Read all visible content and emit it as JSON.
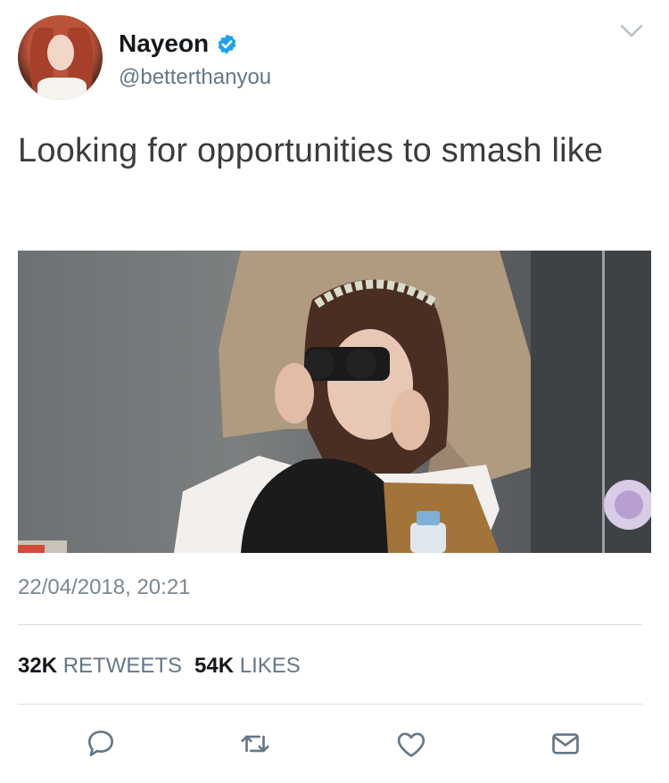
{
  "author": {
    "name": "Nayeon",
    "handle": "@betterthanyou",
    "verified": true
  },
  "tweet": {
    "text": "Looking for opportunities to smash like",
    "timestamp": "22/04/2018, 20:21"
  },
  "stats": {
    "retweets_count": "32K",
    "retweets_label": "RETWEETS",
    "likes_count": "54K",
    "likes_label": "LIKES"
  },
  "colors": {
    "verified_blue": "#1da1f2",
    "secondary_text": "#657786",
    "icon_gray": "#657786"
  },
  "actions": [
    "reply-icon",
    "retweet-icon",
    "like-icon",
    "message-icon"
  ]
}
